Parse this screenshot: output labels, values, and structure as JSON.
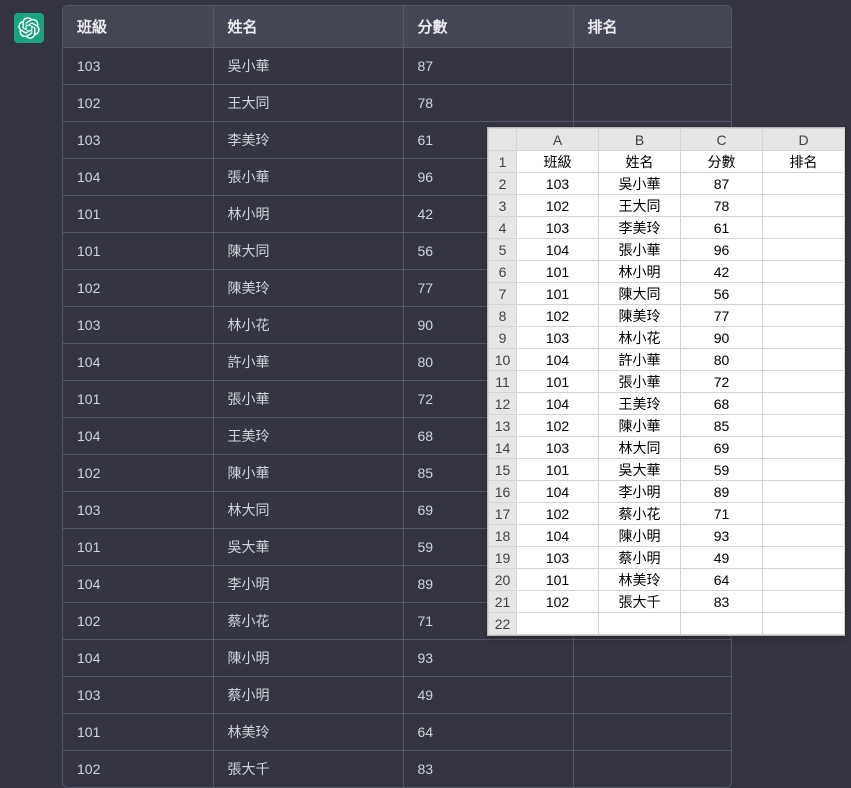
{
  "columns": {
    "class": "班級",
    "name": "姓名",
    "score": "分數",
    "rank": "排名"
  },
  "excel_headers": [
    "A",
    "B",
    "C",
    "D"
  ],
  "rows": [
    {
      "class": "103",
      "name": "吳小華",
      "score": "87",
      "rank": ""
    },
    {
      "class": "102",
      "name": "王大同",
      "score": "78",
      "rank": ""
    },
    {
      "class": "103",
      "name": "李美玲",
      "score": "61",
      "rank": ""
    },
    {
      "class": "104",
      "name": "張小華",
      "score": "96",
      "rank": ""
    },
    {
      "class": "101",
      "name": "林小明",
      "score": "42",
      "rank": ""
    },
    {
      "class": "101",
      "name": "陳大同",
      "score": "56",
      "rank": ""
    },
    {
      "class": "102",
      "name": "陳美玲",
      "score": "77",
      "rank": ""
    },
    {
      "class": "103",
      "name": "林小花",
      "score": "90",
      "rank": ""
    },
    {
      "class": "104",
      "name": "許小華",
      "score": "80",
      "rank": ""
    },
    {
      "class": "101",
      "name": "張小華",
      "score": "72",
      "rank": ""
    },
    {
      "class": "104",
      "name": "王美玲",
      "score": "68",
      "rank": ""
    },
    {
      "class": "102",
      "name": "陳小華",
      "score": "85",
      "rank": ""
    },
    {
      "class": "103",
      "name": "林大同",
      "score": "69",
      "rank": ""
    },
    {
      "class": "101",
      "name": "吳大華",
      "score": "59",
      "rank": ""
    },
    {
      "class": "104",
      "name": "李小明",
      "score": "89",
      "rank": ""
    },
    {
      "class": "102",
      "name": "蔡小花",
      "score": "71",
      "rank": ""
    },
    {
      "class": "104",
      "name": "陳小明",
      "score": "93",
      "rank": ""
    },
    {
      "class": "103",
      "name": "蔡小明",
      "score": "49",
      "rank": ""
    },
    {
      "class": "101",
      "name": "林美玲",
      "score": "64",
      "rank": ""
    },
    {
      "class": "102",
      "name": "張大千",
      "score": "83",
      "rank": ""
    }
  ],
  "chart_data": {
    "type": "table",
    "title": "",
    "columns": [
      "班級",
      "姓名",
      "分數",
      "排名"
    ],
    "data": [
      [
        "103",
        "吳小華",
        87,
        null
      ],
      [
        "102",
        "王大同",
        78,
        null
      ],
      [
        "103",
        "李美玲",
        61,
        null
      ],
      [
        "104",
        "張小華",
        96,
        null
      ],
      [
        "101",
        "林小明",
        42,
        null
      ],
      [
        "101",
        "陳大同",
        56,
        null
      ],
      [
        "102",
        "陳美玲",
        77,
        null
      ],
      [
        "103",
        "林小花",
        90,
        null
      ],
      [
        "104",
        "許小華",
        80,
        null
      ],
      [
        "101",
        "張小華",
        72,
        null
      ],
      [
        "104",
        "王美玲",
        68,
        null
      ],
      [
        "102",
        "陳小華",
        85,
        null
      ],
      [
        "103",
        "林大同",
        69,
        null
      ],
      [
        "101",
        "吳大華",
        59,
        null
      ],
      [
        "104",
        "李小明",
        89,
        null
      ],
      [
        "102",
        "蔡小花",
        71,
        null
      ],
      [
        "104",
        "陳小明",
        93,
        null
      ],
      [
        "103",
        "蔡小明",
        49,
        null
      ],
      [
        "101",
        "林美玲",
        64,
        null
      ],
      [
        "102",
        "張大千",
        83,
        null
      ]
    ]
  }
}
